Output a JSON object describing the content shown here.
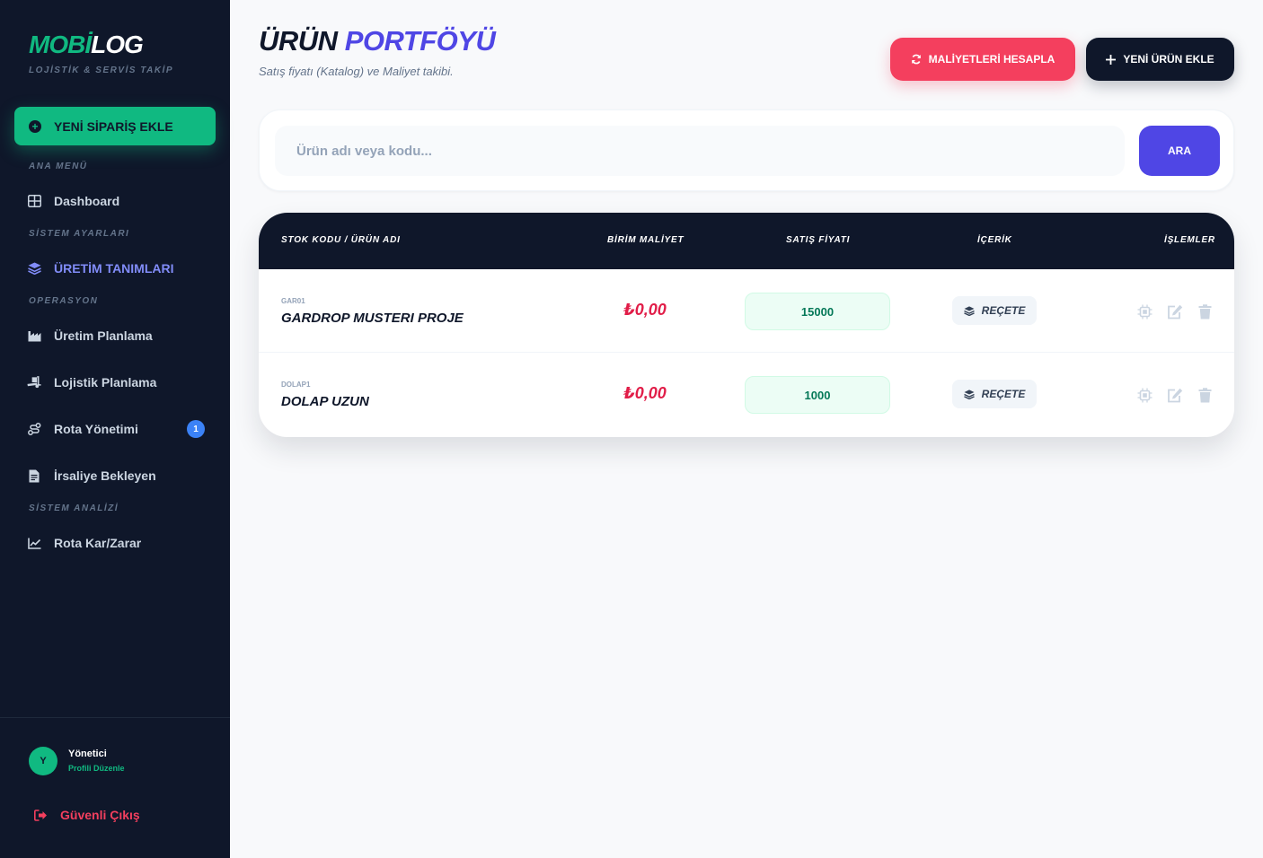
{
  "app": {
    "logo_part1": "MOBİ",
    "logo_part2": "LOG",
    "tagline": "LOJİSTİK & SERVİS TAKİP"
  },
  "sidebar": {
    "new_order_label": "YENİ SİPARİŞ EKLE",
    "sections": {
      "main": "ANA MENÜ",
      "settings": "SİSTEM AYARLARI",
      "operations": "OPERASYON",
      "analysis": "SİSTEM ANALİZİ"
    },
    "items": {
      "dashboard": "Dashboard",
      "production_defs": "ÜRETİM TANIMLARI",
      "production_planning": "Üretim Planlama",
      "logistics_planning": "Lojistik Planlama",
      "route_management": "Rota Yönetimi",
      "route_badge": "1",
      "waybill_pending": "İrsaliye Bekleyen",
      "route_profit": "Rota Kar/Zarar"
    },
    "user": {
      "initial": "Y",
      "name": "Yönetici",
      "edit_profile": "Profili Düzenle"
    },
    "logout": "Güvenli Çıkış"
  },
  "header": {
    "title_part1": "ÜRÜN",
    "title_part2": "PORTFÖYÜ",
    "subtitle": "Satış fiyatı (Katalog) ve Maliyet takibi.",
    "calc_button": "MALİYETLERİ HESAPLA",
    "new_product_button": "YENİ ÜRÜN EKLE"
  },
  "search": {
    "placeholder": "Ürün adı veya kodu...",
    "value": "",
    "button": "ARA"
  },
  "table": {
    "columns": {
      "name": "STOK KODU / ÜRÜN ADI",
      "cost": "BİRİM MALİYET",
      "price": "SATIŞ FİYATI",
      "content": "İÇERİK",
      "actions": "İŞLEMLER"
    },
    "rows": [
      {
        "code": "GAR01",
        "name": "GARDROP MUSTERI PROJE",
        "cost": "₺0,00",
        "price": "15000",
        "recipe": "REÇETE"
      },
      {
        "code": "DOLAP1",
        "name": "DOLAP UZUN",
        "cost": "₺0,00",
        "price": "1000",
        "recipe": "REÇETE"
      }
    ]
  },
  "colors": {
    "sidebar_bg": "#0f172a",
    "accent_green": "#10b981",
    "accent_indigo": "#4f46e5",
    "accent_red": "#f43f5e",
    "active_nav": "#818cf8",
    "badge_blue": "#3b82f6"
  },
  "icons": {
    "new_order": "plus-circle-icon",
    "dashboard": "grid-icon",
    "production_defs": "layers-icon",
    "production_planning": "industry-icon",
    "logistics_planning": "truck-loading-icon",
    "route_management": "route-icon",
    "waybill_pending": "file-invoice-icon",
    "route_profit": "chart-line-icon",
    "logout": "sign-out-icon",
    "calc": "sync-icon",
    "new_product": "plus-icon",
    "recipe": "layers-icon",
    "row_actions": [
      "chip-icon",
      "edit-icon",
      "trash-icon"
    ]
  }
}
